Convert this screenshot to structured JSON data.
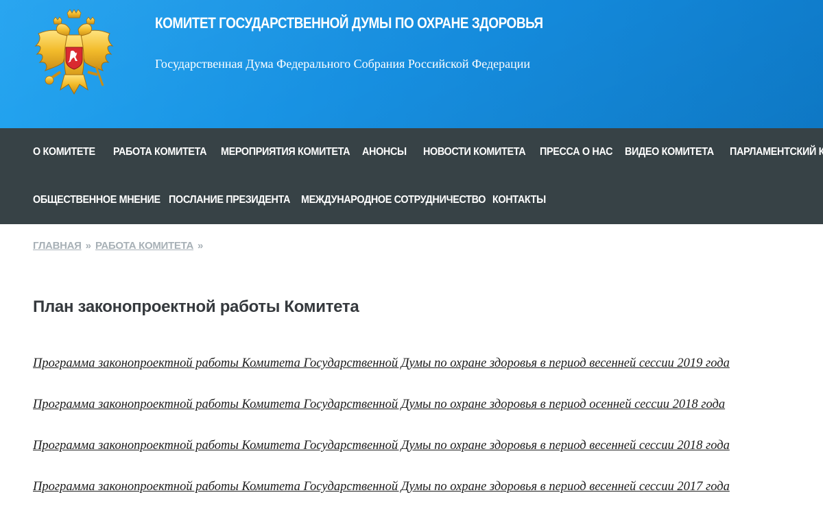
{
  "header": {
    "title": "КОМИТЕТ ГОСУДАРСТВЕННОЙ ДУМЫ ПО ОХРАНЕ ЗДОРОВЬЯ",
    "subtitle": "Государственная Дума Федерального Собрания Российской Федерации",
    "emblem_icon": "russian-coat-of-arms-icon",
    "background_color": "#1a96e8"
  },
  "nav": {
    "background_color": "#374246",
    "row1": [
      {
        "label": "О КОМИТЕТЕ"
      },
      {
        "label": "РАБОТА КОМИТЕТА"
      },
      {
        "label": "МЕРОПРИЯТИЯ КОМИТЕТА"
      },
      {
        "label": "АНОНСЫ"
      },
      {
        "label": "НОВОСТИ КОМИТЕТА"
      },
      {
        "label": "ПРЕССА О НАС"
      },
      {
        "label": "ВИДЕО КОМИТЕТА"
      },
      {
        "label": "ПАРЛАМЕНТСКИЙ КО"
      }
    ],
    "row2": [
      {
        "label": "ОБЩЕСТВЕННОЕ МНЕНИЕ"
      },
      {
        "label": "ПОСЛАНИЕ ПРЕЗИДЕНТА"
      },
      {
        "label": "МЕЖДУНАРОДНОЕ СОТРУДНИЧЕСТВО"
      },
      {
        "label": "КОНТАКТЫ"
      }
    ]
  },
  "breadcrumb": {
    "items": [
      {
        "label": "ГЛАВНАЯ"
      },
      {
        "label": "РАБОТА КОМИТЕТА"
      }
    ],
    "separator": "»"
  },
  "main": {
    "title": "План законопроектной работы Комитета",
    "documents": [
      {
        "label": "Программа законопроектной работы Комитета Государственной Думы по охране здоровья в период весенней сессии 2019 года"
      },
      {
        "label": "Программа законопроектной работы Комитета Государственной Думы по охране здоровья в период осенней сессии 2018 года"
      },
      {
        "label": "Программа законопроектной работы Комитета Государственной Думы по охране здоровья в период весенней сессии 2018 года"
      },
      {
        "label": "Программа законопроектной работы Комитета Государственной Думы по охране здоровья в период весенней сессии 2017 года"
      }
    ]
  }
}
